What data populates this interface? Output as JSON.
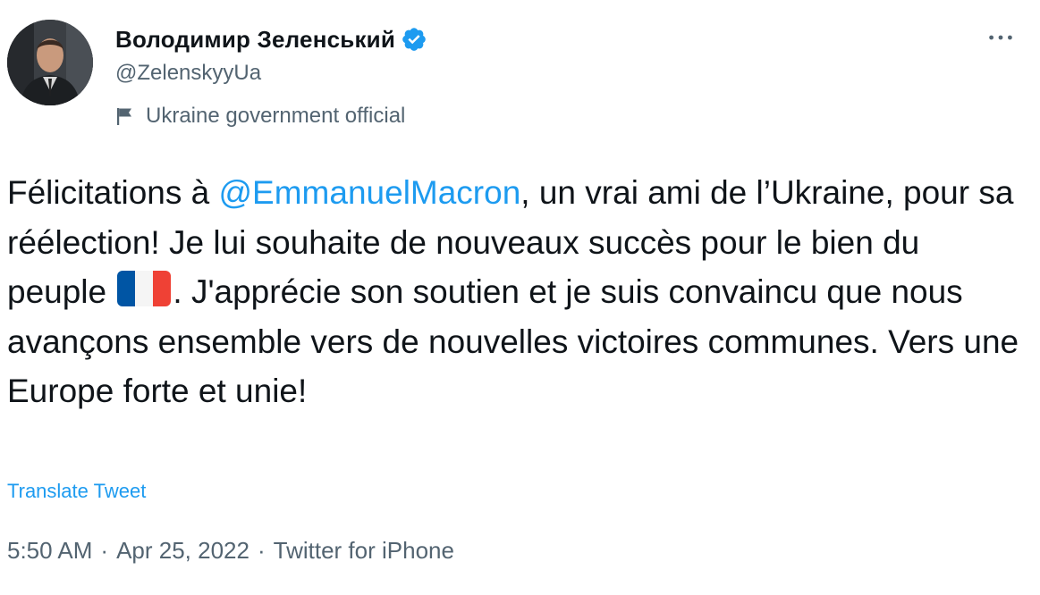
{
  "author": {
    "display_name": "Володимир Зеленський",
    "handle": "@ZelenskyyUa",
    "label": "Ukraine government official",
    "verified_icon": "verified-badge-icon",
    "verified_color": "#1d9bf0"
  },
  "tweet": {
    "text_part1": "Félicitations à ",
    "mention": "@EmmanuelMacron",
    "text_part2": ", un vrai ami de l’Ukraine, pour sa réélection! Je lui souhaite de nouveaux succès pour le bien du peuple ",
    "flag_icon": "france-flag-emoji",
    "text_part3": ". J'apprécie son soutien et je suis convaincu que nous avançons ensemble vers de nouvelles victoires communes. Vers une Europe forte et unie!"
  },
  "translate_label": "Translate Tweet",
  "meta": {
    "time": "5:50 AM",
    "separator": "·",
    "date": "Apr 25, 2022",
    "source": "Twitter for iPhone"
  },
  "colors": {
    "link": "#1d9bf0",
    "secondary_text": "#536471",
    "primary_text": "#0f1419"
  },
  "icons": {
    "more": "more-options-icon",
    "label_flag": "flag-icon"
  }
}
